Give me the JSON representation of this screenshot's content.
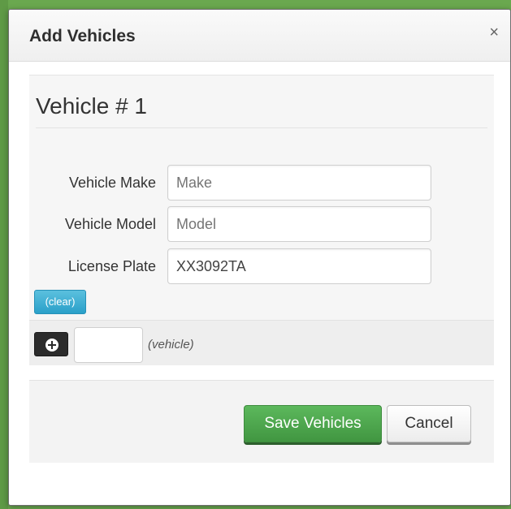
{
  "modal": {
    "title": "Add Vehicles",
    "close_symbol": "×"
  },
  "vehicle": {
    "heading": "Vehicle # 1",
    "fields": [
      {
        "label": "Vehicle Make",
        "value": "",
        "placeholder": "Make"
      },
      {
        "label": "Vehicle Model",
        "value": "",
        "placeholder": "Model"
      },
      {
        "label": "License Plate",
        "value": "XX3092TA",
        "placeholder": ""
      }
    ],
    "clear_label": "(clear)"
  },
  "add_row": {
    "count_value": "",
    "unit_label": "(vehicle)",
    "add_icon": "plus-circle-icon"
  },
  "footer": {
    "save_label": "Save Vehicles",
    "cancel_label": "Cancel"
  },
  "colors": {
    "backdrop": "#6aa84f",
    "save_button": "#5cb85c",
    "clear_button": "#5bc0de",
    "add_button": "#2b2b2b"
  }
}
